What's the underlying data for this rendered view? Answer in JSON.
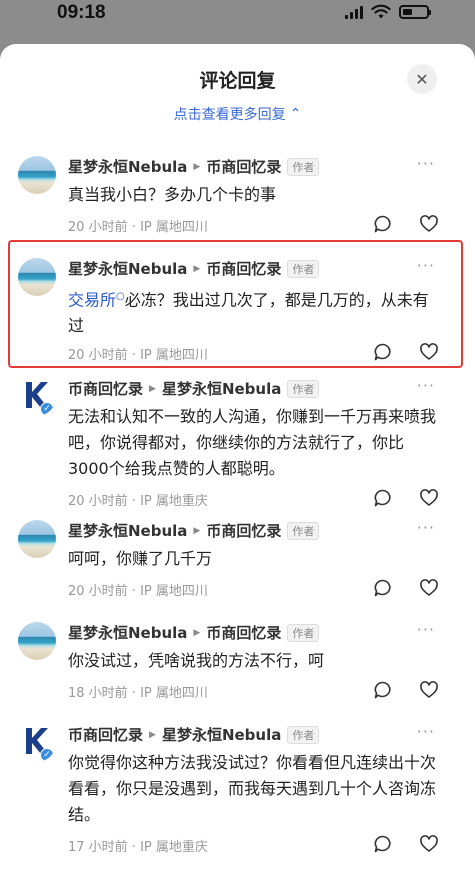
{
  "status": {
    "time": "09:18"
  },
  "sheet": {
    "title": "评论回复",
    "more_replies": "点击查看更多回复"
  },
  "comments": [
    {
      "user": "星梦永恒Nebula",
      "reply_to": "币商回忆录",
      "tag": "作者",
      "link": "",
      "text": "真当我小白？多办几个卡的事",
      "time": "20 小时前",
      "ip": "IP 属地四川",
      "avatar": "beach"
    },
    {
      "user": "星梦永恒Nebula",
      "reply_to": "币商回忆录",
      "tag": "作者",
      "link": "交易所",
      "text": "必冻？我出过几次了，都是几万的，从未有过",
      "time": "20 小时前",
      "ip": "IP 属地四川",
      "avatar": "beach"
    },
    {
      "user": "币商回忆录",
      "reply_to": "星梦永恒Nebula",
      "tag": "作者",
      "link": "",
      "text": "无法和认知不一致的人沟通，你赚到一千万再来喷我吧，你说得都对，你继续你的方法就行了，你比 3000个给我点赞的人都聪明。",
      "time": "20 小时前",
      "ip": "IP 属地重庆",
      "avatar": "logo"
    },
    {
      "user": "星梦永恒Nebula",
      "reply_to": "币商回忆录",
      "tag": "作者",
      "link": "",
      "text": "呵呵，你赚了几千万",
      "time": "20 小时前",
      "ip": "IP 属地四川",
      "avatar": "beach"
    },
    {
      "user": "星梦永恒Nebula",
      "reply_to": "币商回忆录",
      "tag": "作者",
      "link": "",
      "text": "你没试过，凭啥说我的方法不行，呵",
      "time": "18 小时前",
      "ip": "IP 属地四川",
      "avatar": "beach"
    },
    {
      "user": "币商回忆录",
      "reply_to": "星梦永恒Nebula",
      "tag": "作者",
      "link": "",
      "text": "你觉得你这种方法我没试过？你看看但凡连续出十次看看，你只是没遇到，而我每天遇到几十个人咨询冻结。",
      "time": "17 小时前",
      "ip": "IP 属地重庆",
      "avatar": "logo"
    }
  ],
  "colors": {
    "link": "#2a5bc6",
    "highlight": "#e23a36",
    "more_replies": "#3a6ad6"
  }
}
